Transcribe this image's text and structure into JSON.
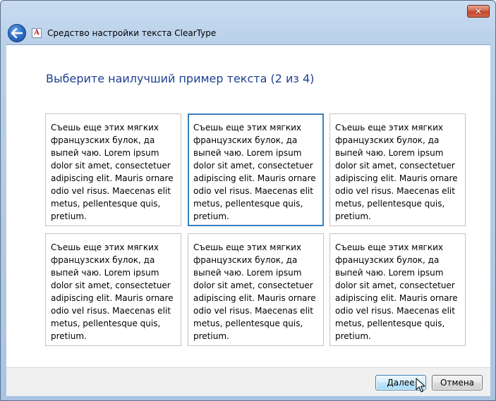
{
  "window": {
    "title": "Средство настройки текста ClearType",
    "close_label": "✕",
    "app_icon_letter": "A"
  },
  "main": {
    "instruction": "Выберите наилучший пример текста (2 из 4)",
    "sample_text": "Съешь еще этих мягких французских булок, да выпей чаю. Lorem ipsum dolor sit amet, consectetuer adipiscing elit. Mauris ornare odio vel risus. Maecenas elit metus, pellentesque quis, pretium.",
    "samples": [
      {
        "text": "Съешь еще этих мягких французских булок, да выпей чаю. Lorem ipsum dolor sit amet, consectetuer adipiscing elit. Mauris ornare odio vel risus. Maecenas elit metus, pellentesque quis, pretium.",
        "selected": false
      },
      {
        "text": "Съешь еще этих мягких французских булок, да выпей чаю. Lorem ipsum dolor sit amet, consectetuer adipiscing elit. Mauris ornare odio vel risus. Maecenas elit metus, pellentesque quis, pretium.",
        "selected": true
      },
      {
        "text": "Съешь еще этих мягких французских булок, да выпей чаю. Lorem ipsum dolor sit amet, consectetuer adipiscing elit. Mauris ornare odio vel risus. Maecenas elit metus, pellentesque quis, pretium.",
        "selected": false
      },
      {
        "text": "Съешь еще этих мягких французских булок, да выпей чаю. Lorem ipsum dolor sit amet, consectetuer adipiscing elit. Mauris ornare odio vel risus. Maecenas elit metus, pellentesque quis, pretium.",
        "selected": false
      },
      {
        "text": "Съешь еще этих мягких французских булок, да выпей чаю. Lorem ipsum dolor sit amet, consectetuer adipiscing elit. Mauris ornare odio vel risus. Maecenas elit metus, pellentesque quis, pretium.",
        "selected": false
      },
      {
        "text": "Съешь еще этих мягких французских булок, да выпей чаю. Lorem ipsum dolor sit amet, consectetuer adipiscing elit. Mauris ornare odio vel risus. Maecenas elit metus, pellentesque quis, pretium.",
        "selected": false
      }
    ]
  },
  "footer": {
    "next_label": "Далее",
    "cancel_label": "Отмена"
  },
  "colors": {
    "instruction": "#1e3f91",
    "selected_border": "#3b7fc4",
    "sample_border": "#c3c3c3"
  },
  "icons": {
    "back": "back-arrow-icon",
    "app": "cleartype-icon",
    "close": "close-icon",
    "cursor": "mouse-pointer-icon"
  }
}
